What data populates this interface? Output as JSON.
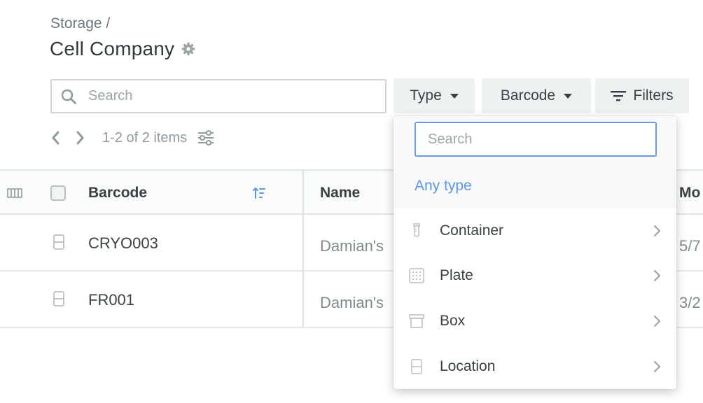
{
  "breadcrumb": "Storage /",
  "page_title": "Cell Company",
  "search": {
    "placeholder": "Search"
  },
  "toolbar": {
    "type_label": "Type",
    "barcode_label": "Barcode",
    "filters_label": "Filters"
  },
  "pager": {
    "count_text": "1-2 of 2 items"
  },
  "table": {
    "columns": [
      "Barcode",
      "Name",
      "Mo"
    ],
    "rows": [
      {
        "barcode": "CRYO003",
        "name": "Damian's",
        "modified": "5/7"
      },
      {
        "barcode": "FR001",
        "name": "Damian's",
        "modified": "3/2"
      }
    ]
  },
  "type_dropdown": {
    "search_placeholder": "Search",
    "any_label": "Any type",
    "items": [
      {
        "label": "Container",
        "icon": "tube-icon"
      },
      {
        "label": "Plate",
        "icon": "plate-icon"
      },
      {
        "label": "Box",
        "icon": "box-icon"
      },
      {
        "label": "Location",
        "icon": "location-icon"
      }
    ]
  },
  "colors": {
    "accent": "#5b96e8",
    "button_bg": "#eef1f2",
    "text": "#3a4143",
    "muted": "#8e9a9c"
  }
}
